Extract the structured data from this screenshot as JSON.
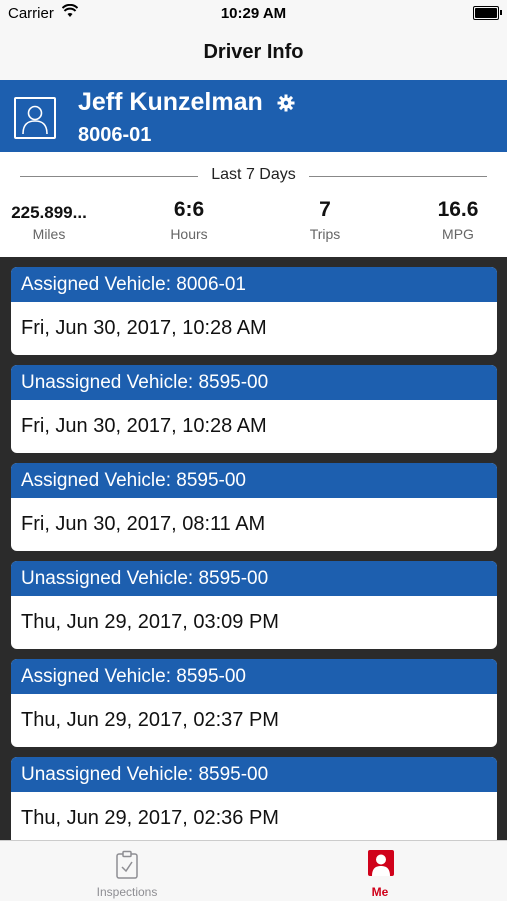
{
  "status_bar": {
    "carrier": "Carrier",
    "time": "10:29 AM"
  },
  "nav": {
    "title": "Driver Info"
  },
  "driver": {
    "name": "Jeff Kunzelman",
    "id": "8006-01"
  },
  "stats": {
    "period_label": "Last 7 Days",
    "items": [
      {
        "value": "225.899...",
        "label": "Miles"
      },
      {
        "value": "6:6",
        "label": "Hours"
      },
      {
        "value": "7",
        "label": "Trips"
      },
      {
        "value": "16.6",
        "label": "MPG"
      }
    ]
  },
  "events": [
    {
      "title": "Assigned Vehicle: 8006-01",
      "time": "Fri, Jun 30, 2017, 10:28 AM"
    },
    {
      "title": "Unassigned Vehicle: 8595-00",
      "time": "Fri, Jun 30, 2017, 10:28 AM"
    },
    {
      "title": "Assigned Vehicle: 8595-00",
      "time": "Fri, Jun 30, 2017, 08:11 AM"
    },
    {
      "title": "Unassigned Vehicle: 8595-00",
      "time": "Thu, Jun 29, 2017, 03:09 PM"
    },
    {
      "title": "Assigned Vehicle: 8595-00",
      "time": "Thu, Jun 29, 2017, 02:37 PM"
    },
    {
      "title": "Unassigned Vehicle: 8595-00",
      "time": "Thu, Jun 29, 2017, 02:36 PM"
    }
  ],
  "tabs": [
    {
      "label": "Inspections",
      "icon": "clipboard-icon",
      "active": false
    },
    {
      "label": "Me",
      "icon": "person-icon",
      "active": true
    }
  ],
  "colors": {
    "brand": "#1d5faf",
    "active_tab": "#d0021b",
    "inactive_tab": "#8e8e93",
    "feed_bg": "#2b2b2b"
  }
}
